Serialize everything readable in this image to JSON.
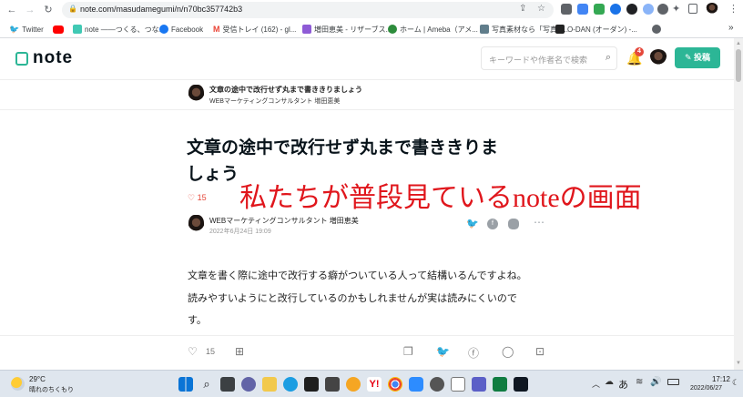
{
  "browser": {
    "url": "note.com/masudamegumi/n/n70bc357742b3",
    "bookmarks": [
      {
        "label": "Twitter",
        "color": "#1d9bf0"
      },
      {
        "label": "",
        "color": "#ff0000"
      },
      {
        "label": "note ――つくる、つな...",
        "color": "#41c9b4"
      },
      {
        "label": "Facebook",
        "color": "#1877f2"
      },
      {
        "label": "受信トレイ (162) - gl...",
        "color": "#ea4335"
      },
      {
        "label": "増田恵美 - リザーブス...",
        "color": "#8e5bd6"
      },
      {
        "label": "ホーム | Ameba（アメ...",
        "color": "#2d8c3c"
      },
      {
        "label": "写真素材なら「写真A...",
        "color": "#607d8b"
      },
      {
        "label": "O-DAN (オーダン) -...",
        "color": "#222222"
      }
    ],
    "more_bookmarks": "»"
  },
  "note": {
    "logo": "note",
    "search_placeholder": "キーワードや作者名で検索",
    "notification_count": "4",
    "post_button": "投稿"
  },
  "mini_header": {
    "title": "文章の途中で改行せず丸まで書ききりましょう",
    "author": "WEBマーケティングコンサルタント 増田恵美"
  },
  "article": {
    "title_line1": "文章の途中で改行せず丸まで書ききりま",
    "title_line2": "しょう",
    "likes": "15",
    "author": "WEBマーケティングコンサルタント 増田恵美",
    "date": "2022年6月24日 19:09",
    "body_lines": [
      "文章を書く際に途中で改行する癖がついている人って結構いるんですよね。",
      "読みやすいようにと改行しているのかもしれませんが実は読みにくいので",
      "す。"
    ]
  },
  "overlay_text": "私たちが普段見ているnoteの画面",
  "action_bar": {
    "likes": "15"
  },
  "taskbar": {
    "temperature": "29°C",
    "weather": "晴れのちくもり",
    "ime": "あ",
    "time": "17:12",
    "date": "2022/06/27"
  },
  "colors": {
    "note_green": "#2cb696",
    "overlay_red": "#e0161c",
    "like_red": "#e5483b"
  }
}
